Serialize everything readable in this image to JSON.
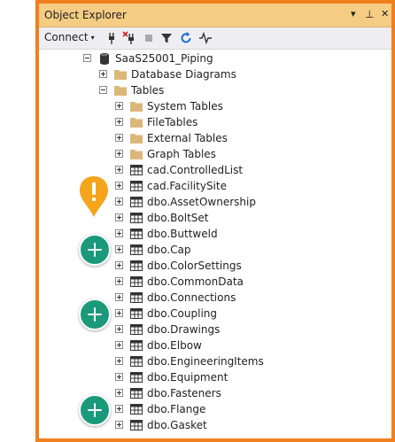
{
  "window": {
    "title": "Object Explorer",
    "controls": {
      "dropdown": "▾",
      "pin": "⊥",
      "close": "✕"
    }
  },
  "toolbar": {
    "connect_label": "Connect",
    "connect_caret": "▾"
  },
  "tree": {
    "server": "SaaS25001_Piping",
    "database_diagrams": "Database Diagrams",
    "tables": "Tables",
    "folders": [
      "System Tables",
      "FileTables",
      "External Tables",
      "Graph Tables"
    ],
    "table_items": [
      "cad.ControlledList",
      "cad.FacilitySite",
      "dbo.AssetOwnership",
      "dbo.BoltSet",
      "dbo.Buttweld",
      "dbo.Cap",
      "dbo.ColorSettings",
      "dbo.CommonData",
      "dbo.Connections",
      "dbo.Coupling",
      "dbo.Drawings",
      "dbo.Elbow",
      "dbo.EngineeringItems",
      "dbo.Equipment",
      "dbo.Fasteners",
      "dbo.Flange",
      "dbo.Gasket"
    ]
  },
  "colors": {
    "frame_border": "#f07f1e",
    "title_bar": "#f5cc84",
    "folder": "#dcb67a",
    "badge_green": "#1a9a7a",
    "warning_pin": "#f4a51c"
  },
  "icons": {
    "connect_plug": "plug-icon",
    "disconnect": "disconnect-icon",
    "stop": "stop-icon",
    "filter": "filter-icon",
    "refresh": "refresh-icon",
    "activity": "activity-monitor-icon",
    "database": "database-icon",
    "folder": "folder-icon",
    "table": "table-icon",
    "warning": "warning-pin-icon",
    "add": "add-circle-icon"
  }
}
